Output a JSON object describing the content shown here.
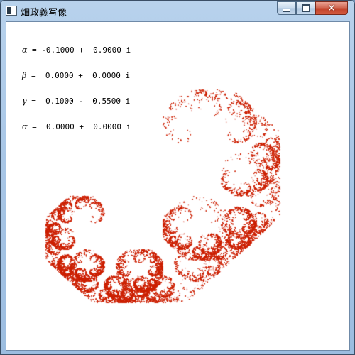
{
  "window": {
    "title": "畑政義写像",
    "icons": {
      "app": "window-app-icon",
      "minimize": "minimize-icon",
      "maximize": "maximize-icon",
      "close": "close-icon"
    }
  },
  "parameters": [
    {
      "symbol": "α",
      "text": " = -0.1000 +  0.9000 i"
    },
    {
      "symbol": "β",
      "text": " =  0.0000 +  0.0000 i"
    },
    {
      "symbol": "γ",
      "text": " =  0.1000 -  0.5500 i"
    },
    {
      "symbol": "σ",
      "text": " =  0.0000 +  0.0000 i"
    }
  ],
  "colors": {
    "fractal": "#cc2200",
    "background": "#ffffff"
  },
  "controls": {
    "close_glyph": "✕"
  }
}
